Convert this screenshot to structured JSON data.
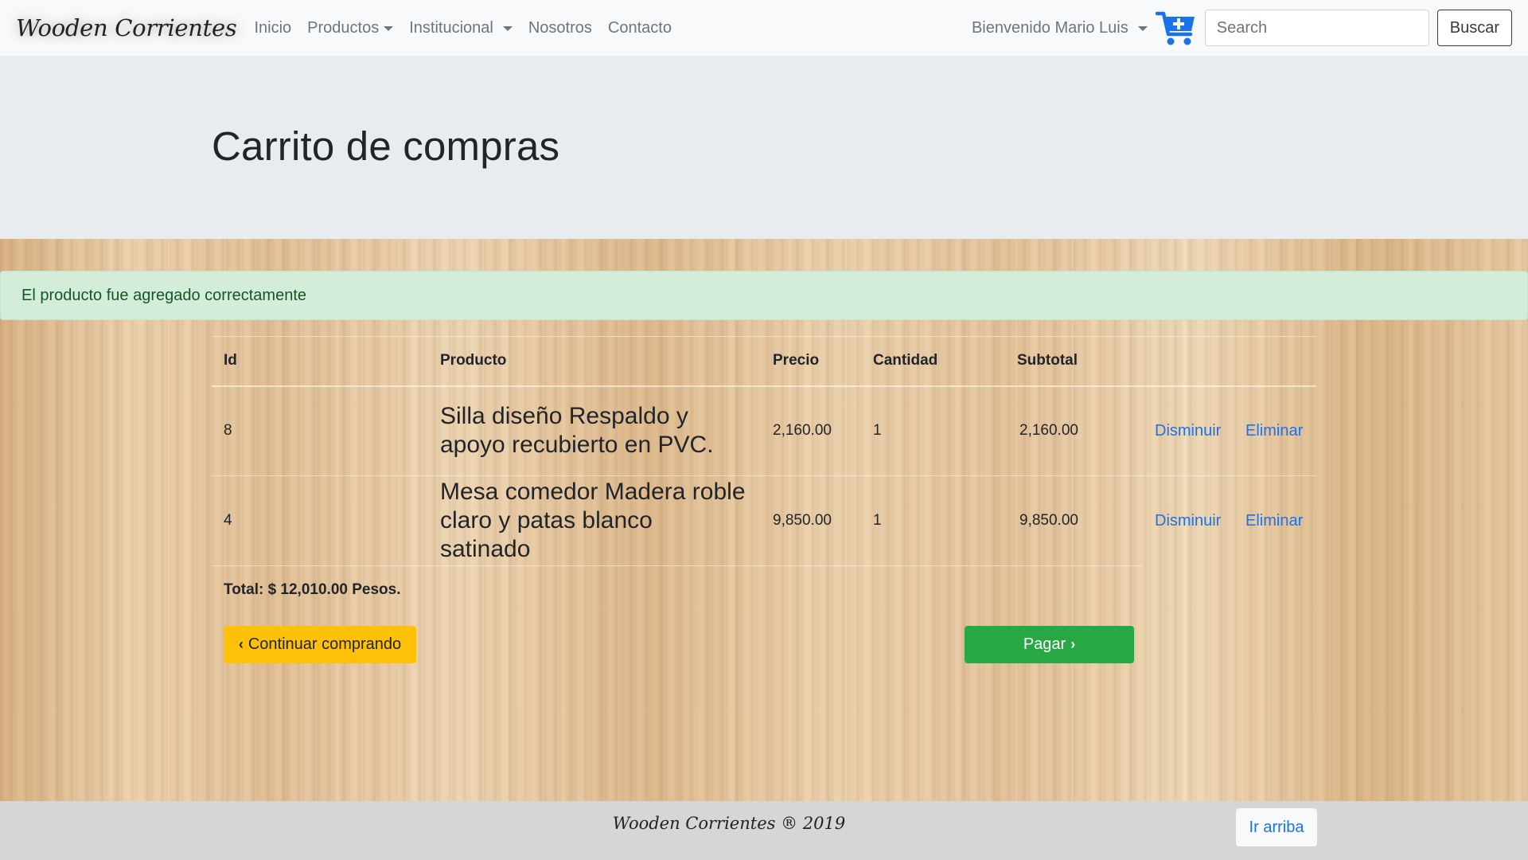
{
  "navbar": {
    "brand": "Wooden Corrientes",
    "links": [
      {
        "label": "Inicio"
      },
      {
        "label": "Productos"
      },
      {
        "label": "Institucional"
      },
      {
        "label": "Nosotros"
      },
      {
        "label": "Contacto"
      }
    ],
    "user_menu": "Bienvenido Mario Luis",
    "cart_icon": "cart-plus-icon",
    "search_placeholder": "Search",
    "search_button": "Buscar"
  },
  "header": {
    "title": "Carrito de compras"
  },
  "alert": {
    "message": "El producto fue agregado correctamente"
  },
  "cart": {
    "columns": [
      "Id",
      "Producto",
      "Precio",
      "Cantidad",
      "Subtotal"
    ],
    "items": [
      {
        "id": "8",
        "product": "Silla diseño Respaldo y apoyo recubierto en PVC.",
        "price": "2,160.00",
        "quantity": "1",
        "subtotal": "2,160.00",
        "decrease": "Disminuir",
        "remove": "Eliminar"
      },
      {
        "id": "4",
        "product": "Mesa comedor Madera roble claro y patas blanco satinado",
        "price": "9,850.00",
        "quantity": "1",
        "subtotal": "9,850.00",
        "decrease": "Disminuir",
        "remove": "Eliminar"
      }
    ],
    "total": "Total: $ 12,010.00 Pesos.",
    "continue_button": "Continuar comprando",
    "pay_button": "Pagar"
  },
  "footer": {
    "text": "Wooden Corrientes ® 2019",
    "back_to_top": "Ir arriba"
  },
  "colors": {
    "accent_blue": "#1a73e8",
    "warning": "#ffc107",
    "success": "#28a745",
    "alert_bg": "#d4edda",
    "alert_text": "#155724"
  }
}
